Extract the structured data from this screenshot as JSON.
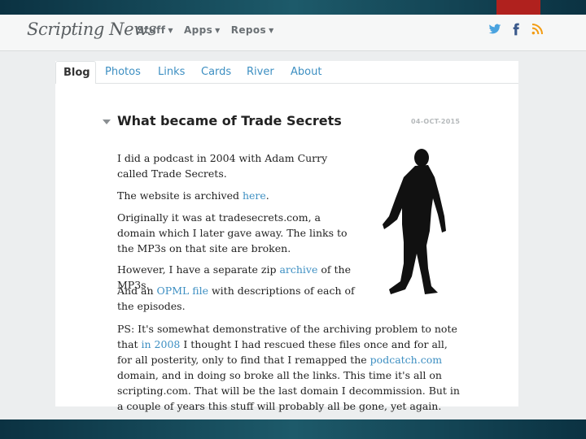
{
  "site": {
    "brand": "Scripting News",
    "menu": [
      {
        "label": "Stuff"
      },
      {
        "label": "Apps"
      },
      {
        "label": "Repos"
      }
    ],
    "social": [
      "twitter-icon",
      "facebook-icon",
      "rss-icon"
    ]
  },
  "colors": {
    "link": "#3d8fc2",
    "accent_red": "#b0211e",
    "frame": "#0f3b4c"
  },
  "tabs": [
    "Blog",
    "Photos",
    "Links",
    "Cards",
    "River",
    "About"
  ],
  "post": {
    "title": "What became of Trade Secrets",
    "date": "04-OCT-2015",
    "p1": "I did a podcast in 2004 with Adam Curry called Trade Secrets.",
    "p2_text": "The website is archived ",
    "p2_link": "here",
    "p2_end": ".",
    "p3": "Originally it was at tradesecrets.com, a domain which I later gave away. The links to the MP3s on that site are broken.",
    "p4_text": "However, I have a separate zip ",
    "p4_link": "archive",
    "p4_end": " of the MP3s.",
    "p5_text": "And an ",
    "p5_link": "OPML file",
    "p5_end": " with descriptions of each of the episodes.",
    "p6_text": "PS: It's somewhat demonstrative of the archiving problem to note that ",
    "p6_link1": "in 2008",
    "p6_mid": " I thought I had rescued these files once and for all, for all posterity, only to find that I remapped the ",
    "p6_link2": "podcatch.com",
    "p6_end": " domain, and in doing so broke all the links. This time it's all on scripting.com. That will be the last domain I decommission. But in a couple of years this stuff will probably all be gone, yet again."
  }
}
